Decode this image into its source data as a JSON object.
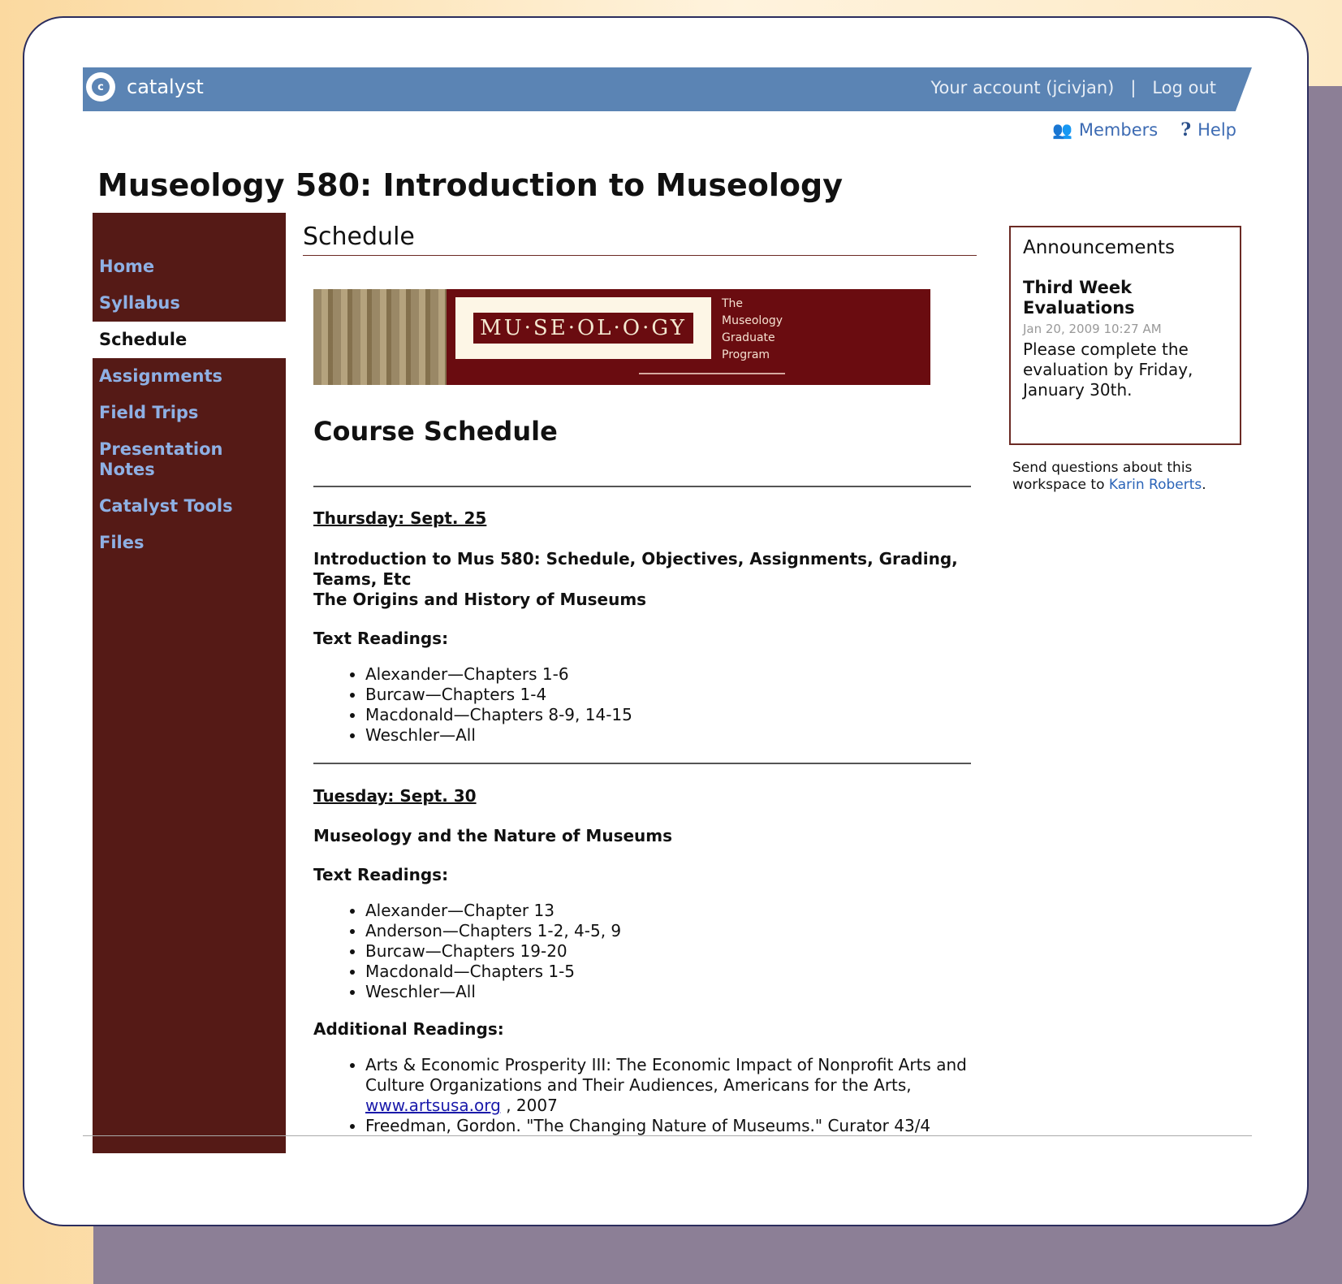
{
  "header": {
    "logo_text": "catalyst",
    "account_label": "Your account (jcivjan)",
    "separator": "|",
    "logout_label": "Log out"
  },
  "utility": {
    "members_label": "Members",
    "help_label": "Help"
  },
  "page_title": "Museology 580: Introduction to Museology",
  "sidebar": {
    "items": [
      {
        "label": "Home"
      },
      {
        "label": "Syllabus"
      },
      {
        "label": "Schedule"
      },
      {
        "label": "Assignments"
      },
      {
        "label": "Field Trips"
      },
      {
        "label": "Presentation Notes"
      },
      {
        "label": "Catalyst Tools"
      },
      {
        "label": "Files"
      }
    ]
  },
  "section_heading": "Schedule",
  "banner": {
    "wordmark": "MU·SE·OL·O·GY",
    "sub_lines": [
      "The",
      "Museology",
      "Graduate",
      "Program"
    ]
  },
  "course": {
    "heading": "Course Schedule",
    "days": [
      {
        "date": "Thursday:  Sept. 25",
        "topics": [
          "Introduction to Mus 580: Schedule, Objectives, Assignments, Grading, Teams, Etc",
          "The Origins and History of Museums"
        ],
        "text_readings_label": "Text Readings:",
        "text_readings": [
          "Alexander—Chapters 1-6",
          "Burcaw—Chapters 1-4",
          "Macdonald—Chapters 8-9, 14-15",
          "Weschler—All"
        ]
      },
      {
        "date": "Tuesday:  Sept. 30",
        "topics": [
          "Museology and the Nature of Museums"
        ],
        "text_readings_label": "Text Readings:",
        "text_readings": [
          "Alexander—Chapter 13",
          "Anderson—Chapters 1-2, 4-5, 9",
          "Burcaw—Chapters 19-20",
          "Macdonald—Chapters 1-5",
          "Weschler—All"
        ],
        "additional_label": "Additional Readings:",
        "additional": {
          "item1_before": "Arts & Economic Prosperity III: The Economic Impact of Nonprofit Arts and Culture Organizations and Their Audiences, Americans for the Arts,",
          "item1_link": "www.artsusa.org",
          "item1_after": ", 2007",
          "item2": "Freedman, Gordon. \"The Changing Nature of Museums.\" Curator 43/4"
        }
      }
    ]
  },
  "announcements": {
    "title": "Announcements",
    "item_title": "Third Week Evaluations",
    "item_date": "Jan 20, 2009 10:27 AM",
    "item_body": "Please complete the evaluation by Friday, January 30th."
  },
  "contact": {
    "text": "Send questions about this workspace to",
    "name": "Karin Roberts",
    "end": "."
  },
  "colors": {
    "sidebar": "#551a16",
    "topbar": "#5b84b4",
    "nav_link": "#8eb0e4",
    "banner": "#6a0c10"
  }
}
